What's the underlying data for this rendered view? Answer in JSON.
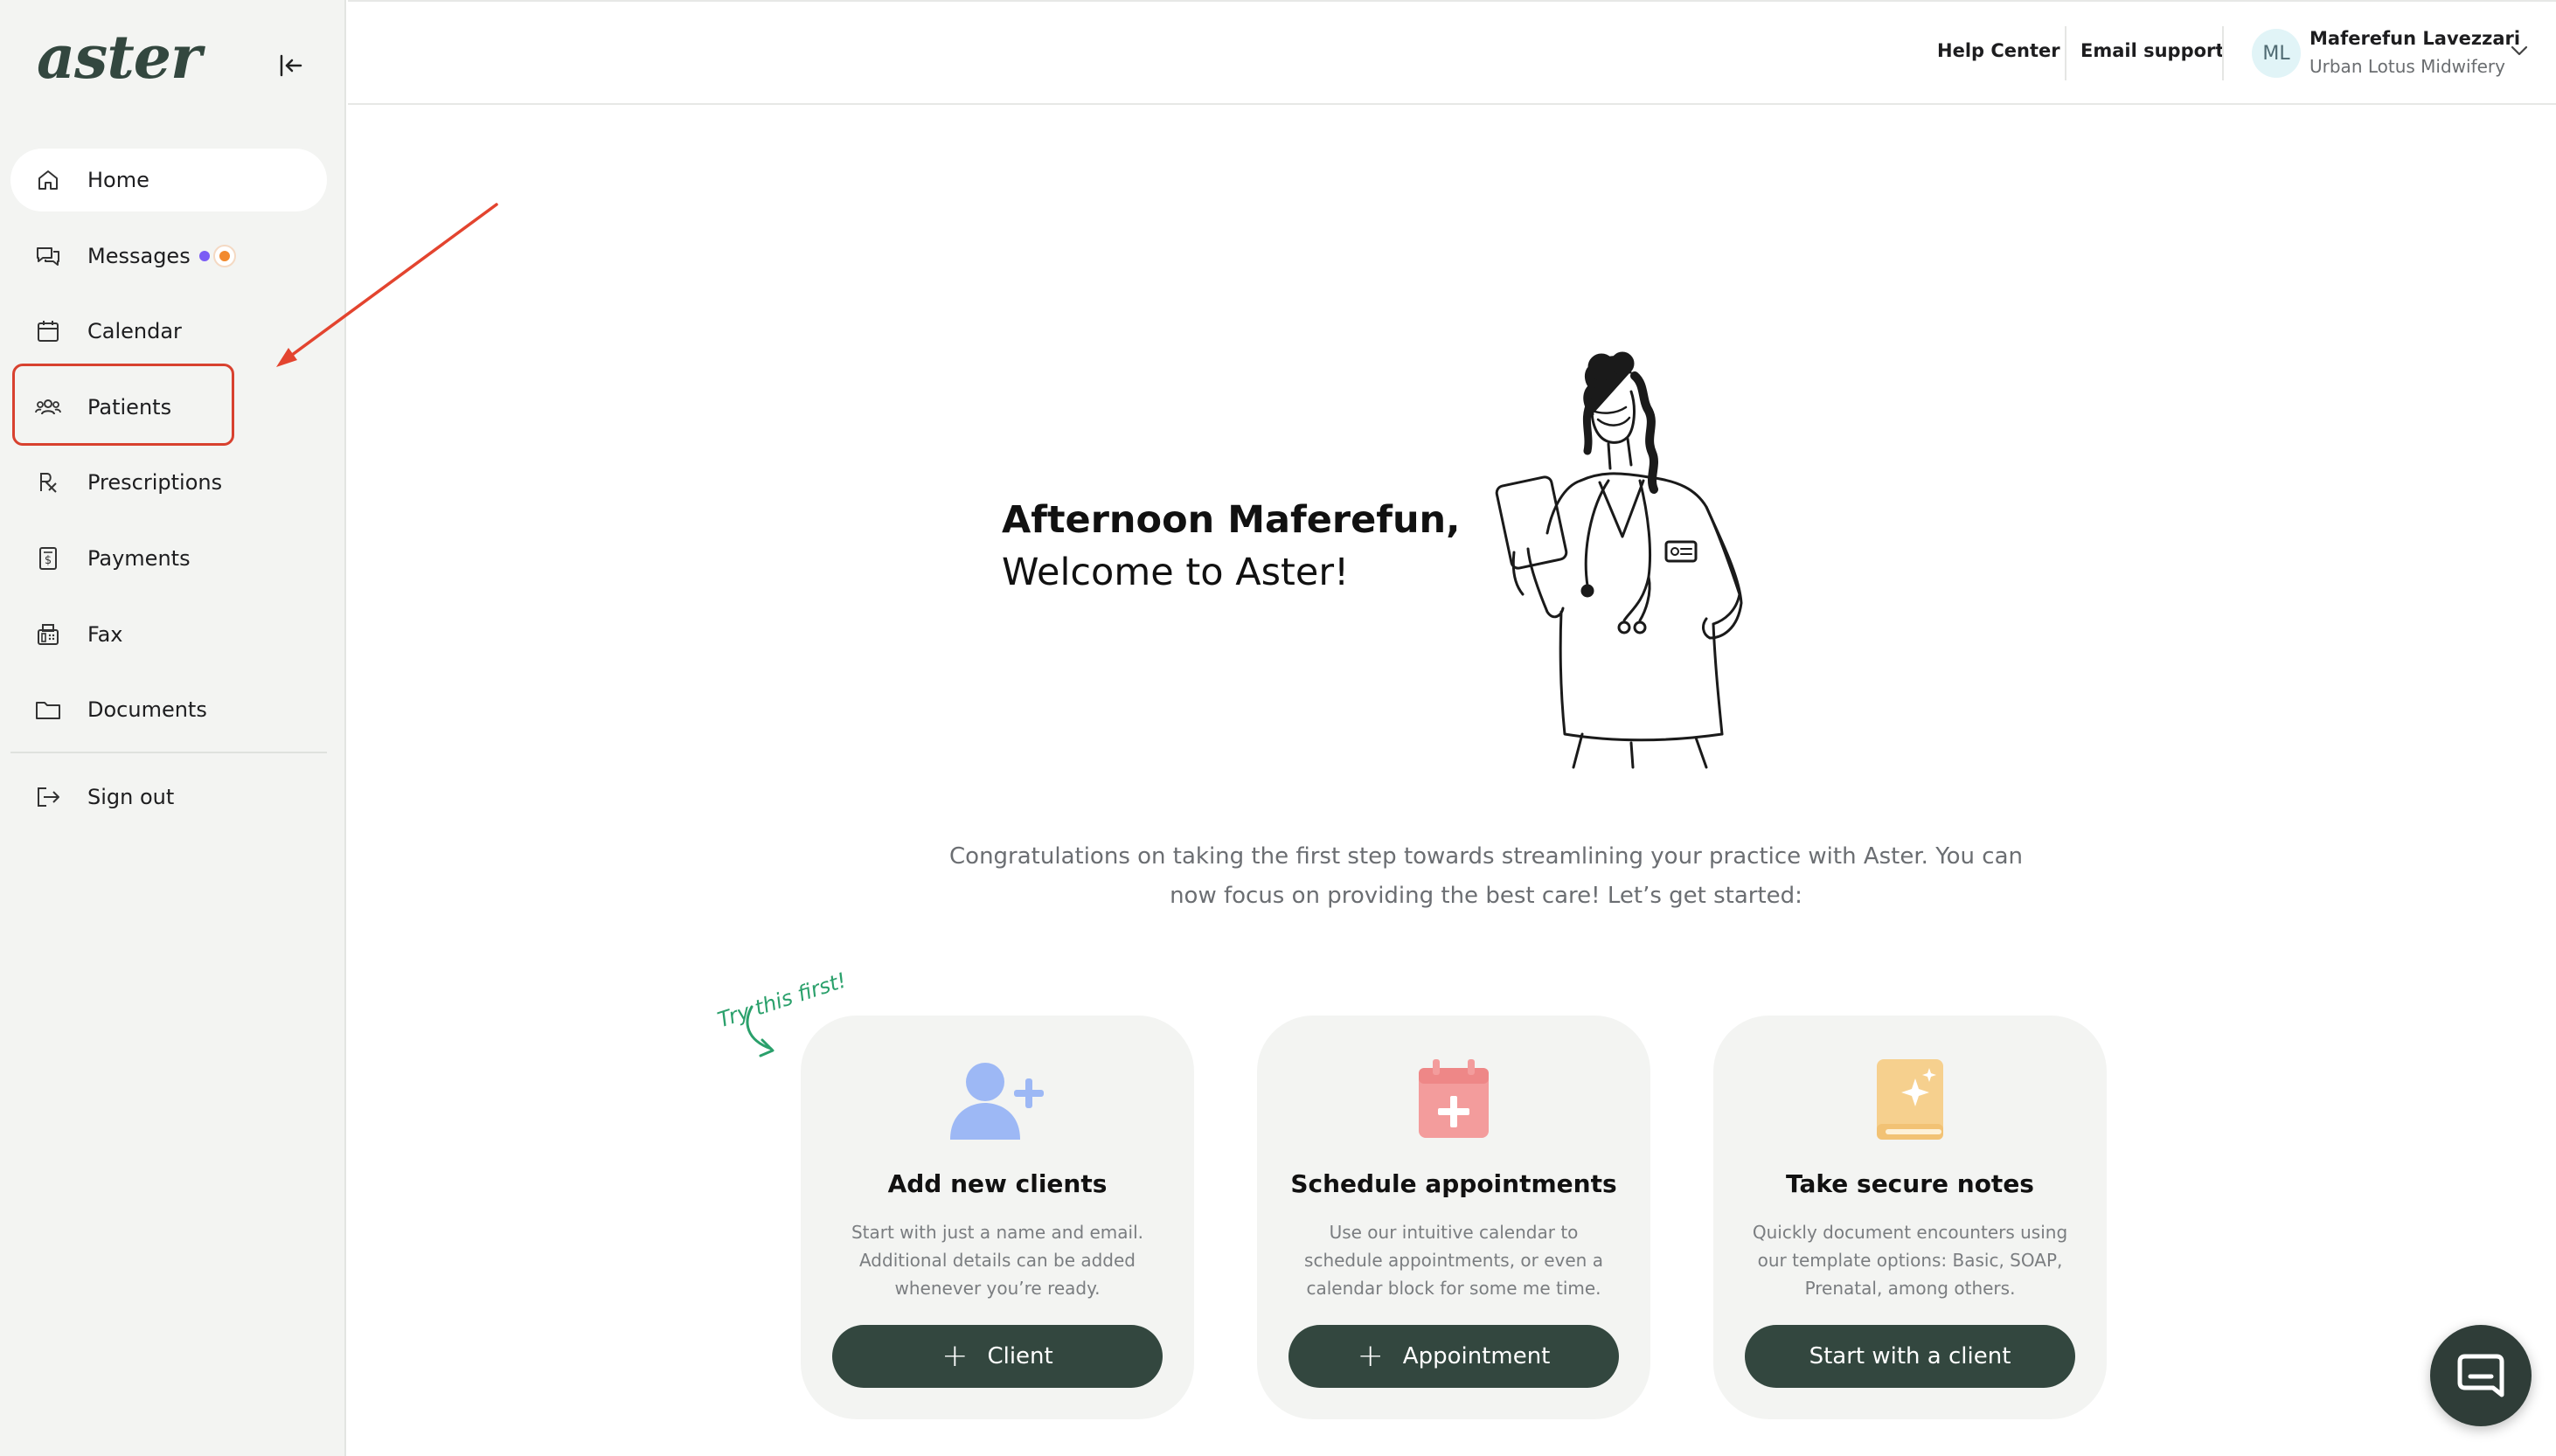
{
  "sidebar": {
    "brand": "aster",
    "items": [
      {
        "label": "Home",
        "icon": "home-icon",
        "active": true
      },
      {
        "label": "Messages",
        "icon": "messages-icon"
      },
      {
        "label": "Calendar",
        "icon": "calendar-icon"
      },
      {
        "label": "Patients",
        "icon": "patients-icon",
        "highlighted": true
      },
      {
        "label": "Prescriptions",
        "icon": "prescription-icon"
      },
      {
        "label": "Payments",
        "icon": "payments-icon"
      },
      {
        "label": "Fax",
        "icon": "fax-icon"
      },
      {
        "label": "Documents",
        "icon": "documents-icon"
      }
    ],
    "signout_label": "Sign out"
  },
  "header": {
    "help_center": "Help Center",
    "email_support": "Email support",
    "user": {
      "initials": "ML",
      "name": "Maferefun Lavezzari",
      "org": "Urban Lotus Midwifery"
    }
  },
  "main": {
    "greeting_line1": "Afternoon Maferefun,",
    "greeting_line2": "Welcome to Aster!",
    "intro": "Congratulations on taking the first step towards streamlining your practice with Aster. You can now focus on providing the best care! Let’s get started:",
    "try_first": "Try this first!",
    "cards": [
      {
        "title": "Add new clients",
        "desc": "Start with just a name and email. Additional details can be added whenever you’re ready.",
        "button": "Client",
        "icon": "add-user-icon",
        "color": "#9db8f5"
      },
      {
        "title": "Schedule appointments",
        "desc": "Use our intuitive calendar to schedule appointments, or even a calendar block for some me time.",
        "button": "Appointment",
        "icon": "calendar-plus-icon",
        "color": "#f39c9c"
      },
      {
        "title": "Take secure notes",
        "desc": "Quickly document encounters using our template options: Basic, SOAP, Prenatal, among others.",
        "button": "Start with a client",
        "icon": "notebook-icon",
        "color": "#f6d08e"
      }
    ]
  },
  "colors": {
    "brand": "#33473f",
    "sidebar_bg": "#f3f4f2",
    "highlight": "#d8412f",
    "try_first": "#2aa06b"
  }
}
